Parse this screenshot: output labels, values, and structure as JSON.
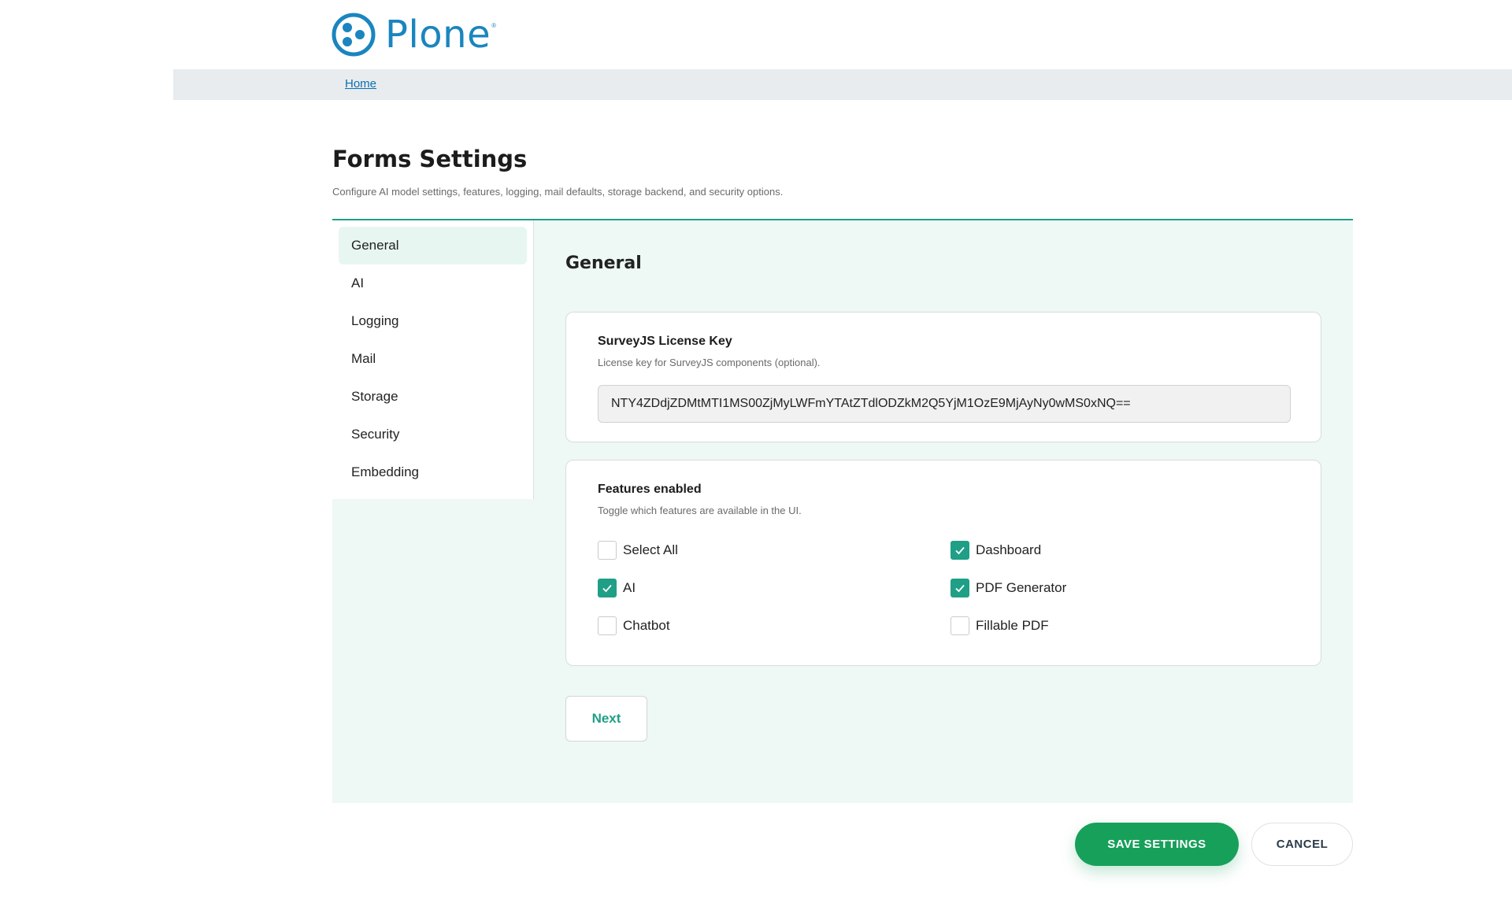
{
  "brand": {
    "name": "Plone",
    "registered_mark": "®",
    "color": "#1a85bf"
  },
  "breadcrumb": {
    "home": "Home"
  },
  "page": {
    "title": "Forms Settings",
    "description": "Configure AI model settings, features, logging, mail defaults, storage backend, and security options."
  },
  "sidebar": {
    "active": "General",
    "items": [
      {
        "label": "General"
      },
      {
        "label": "AI"
      },
      {
        "label": "Logging"
      },
      {
        "label": "Mail"
      },
      {
        "label": "Storage"
      },
      {
        "label": "Security"
      },
      {
        "label": "Embedding"
      }
    ]
  },
  "section": {
    "title": "General",
    "license": {
      "label": "SurveyJS License Key",
      "help": "License key for SurveyJS components (optional).",
      "value": "NTY4ZDdjZDMtMTI1MS00ZjMyLWFmYTAtZTdlODZkM2Q5YjM1OzE9MjAyNy0wMS0xNQ=="
    },
    "features": {
      "label": "Features enabled",
      "help": "Toggle which features are available in the UI.",
      "options": [
        {
          "label": "Select All",
          "checked": false
        },
        {
          "label": "Dashboard",
          "checked": true
        },
        {
          "label": "AI",
          "checked": true
        },
        {
          "label": "PDF Generator",
          "checked": true
        },
        {
          "label": "Chatbot",
          "checked": false
        },
        {
          "label": "Fillable PDF",
          "checked": false
        }
      ]
    },
    "next_label": "Next"
  },
  "actions": {
    "save_label": "SAVE SETTINGS",
    "cancel_label": "CANCEL"
  },
  "colors": {
    "accent": "#1f9f86",
    "save": "#17a05a",
    "panel_bg": "#eef8f5"
  }
}
